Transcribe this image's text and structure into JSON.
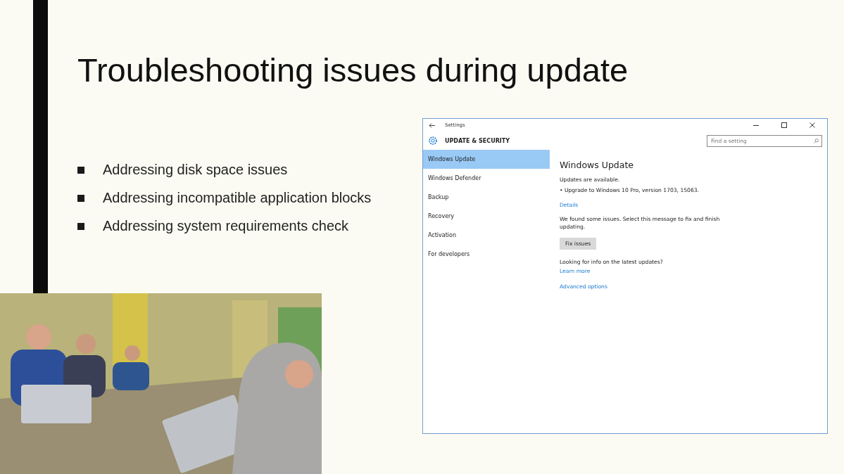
{
  "slide": {
    "title": "Troubleshooting issues during update",
    "bullets": [
      "Addressing disk space issues",
      "Addressing incompatible application blocks",
      "Addressing system requirements check"
    ]
  },
  "settings_window": {
    "title": "Settings",
    "section": "UPDATE & SECURITY",
    "search": {
      "placeholder": "Find a setting"
    },
    "nav_items": [
      {
        "label": "Windows Update",
        "selected": true
      },
      {
        "label": "Windows Defender",
        "selected": false
      },
      {
        "label": "Backup",
        "selected": false
      },
      {
        "label": "Recovery",
        "selected": false
      },
      {
        "label": "Activation",
        "selected": false
      },
      {
        "label": "For developers",
        "selected": false
      }
    ],
    "content": {
      "heading": "Windows Update",
      "status": "Updates are available.",
      "update_item": "• Upgrade to Windows 10 Pro, version 1703, 15063.",
      "details_link": "Details",
      "message": "We found some issues. Select this message to fix and finish updating.",
      "fix_button": "Fix issues",
      "info_question": "Looking for info on the latest updates?",
      "learn_more_link": "Learn more",
      "advanced_link": "Advanced options"
    }
  }
}
